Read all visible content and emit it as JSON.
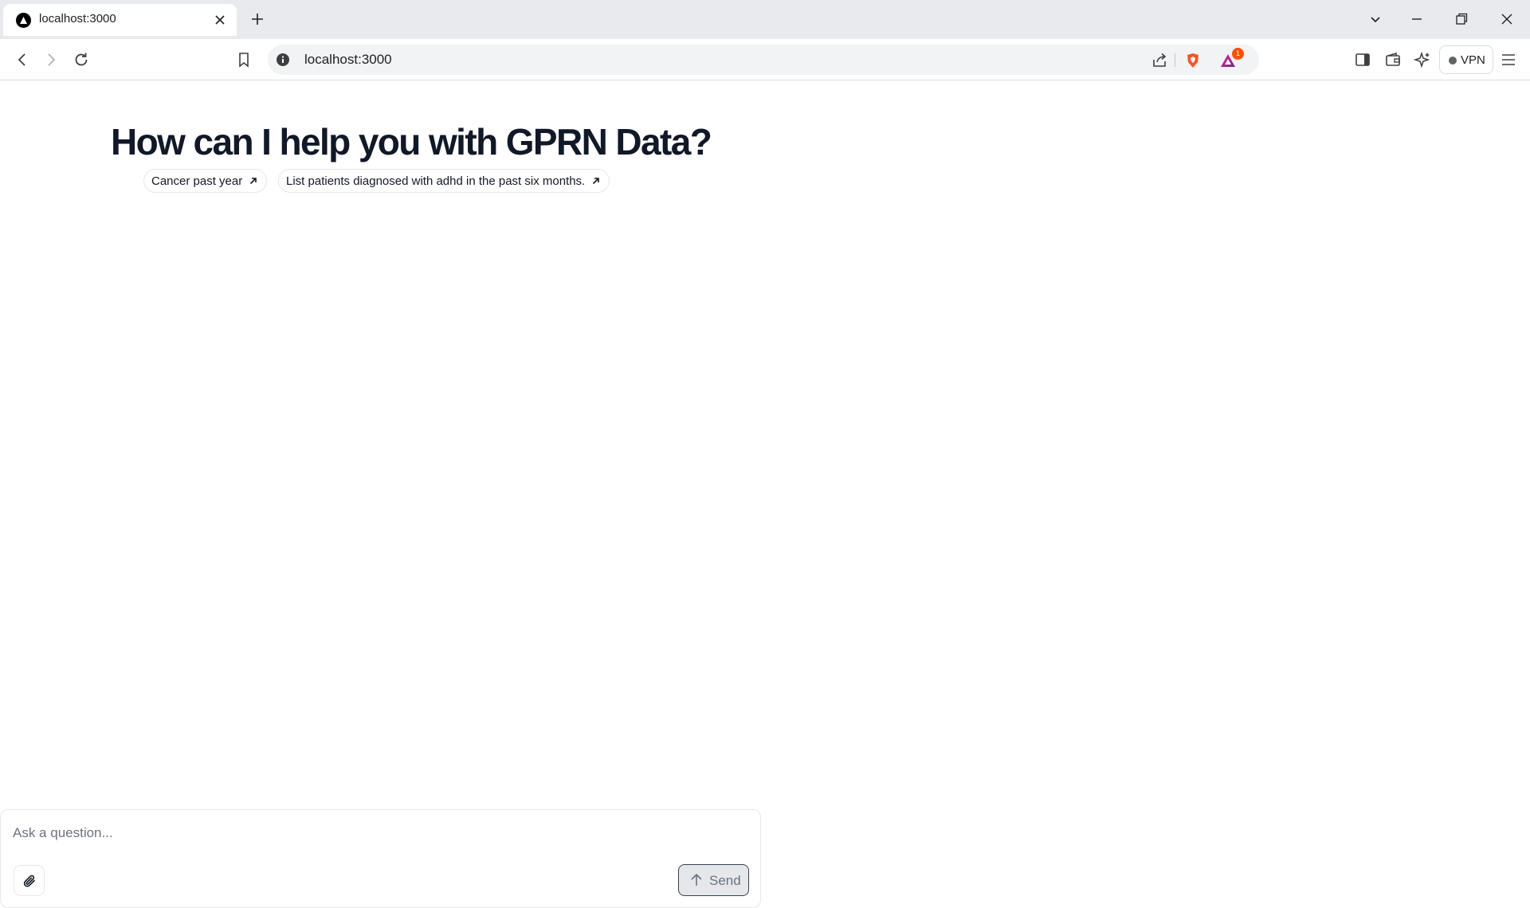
{
  "browser": {
    "tab_title": "localhost:3000",
    "url": "localhost:3000",
    "notification_count": "1",
    "vpn_label": "VPN"
  },
  "page": {
    "heading": "How can I help you with GPRN Data?",
    "suggestions": [
      {
        "label": "Cancer past year"
      },
      {
        "label": "List patients diagnosed with adhd in the past six months."
      }
    ]
  },
  "composer": {
    "placeholder": "Ask a question...",
    "value": "",
    "send_label": "Send"
  },
  "icons": {
    "favicon": "triangle-logo-icon",
    "attach": "paperclip-icon",
    "send": "arrow-up-icon"
  },
  "colors": {
    "heading": "#111827",
    "send_border": "#374151",
    "send_bg": "#e5e7eb",
    "badge": "#ff5000"
  }
}
